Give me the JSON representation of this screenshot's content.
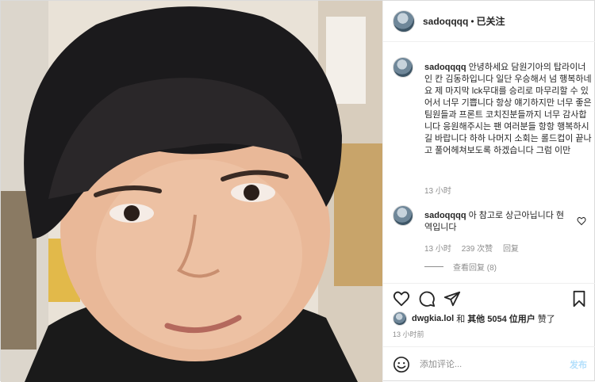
{
  "header": {
    "username": "sadoqqqq",
    "dot": "•",
    "follow_label": "已关注",
    "more_icon": "more-horizontal-icon"
  },
  "comments": [
    {
      "username": "sadoqqqq",
      "text": "안녕하세요 담원기아의 탑라이너인 칸 김동하입니다 일단 우승해서 넘 행복하네요 제 마지막 lck무대를 승리로 마무리할 수 있어서 너무 기쁩니다 항상 얘기하지만 너무 좋은 팀원들과 프론트 코치진분들까지 너무 감사합니다 응원해주시는 팬 여러분들 항항 행복하시길 바랍니다 하하 나머지 소회는 롤드컵이 끝나고 풀어헤쳐보도록 하겠습니다 그럼 이만",
      "time": "13 小时"
    },
    {
      "username": "sadoqqqq",
      "text": "아 참고로 상근아닙니다 현역입니다",
      "time": "13 小时",
      "likes": "239 次赞",
      "reply": "回复",
      "view_replies": "查看回复 (8)"
    }
  ],
  "actions": {
    "like_icon": "heart-icon",
    "comment_icon": "comment-icon",
    "share_icon": "share-icon",
    "save_icon": "bookmark-icon"
  },
  "likes": {
    "liker": "dwgkia.lol",
    "conj": "和",
    "others": "其他 5054 位用户",
    "suffix": "赞了"
  },
  "post_time": "13 小时前",
  "add_comment": {
    "placeholder": "添加评论...",
    "post_label": "发布",
    "emoji_icon": "emoji-icon"
  },
  "colors": {
    "border": "#dbdbdb",
    "muted_text": "#8e8e8e",
    "post_button": "#b2dffc"
  }
}
